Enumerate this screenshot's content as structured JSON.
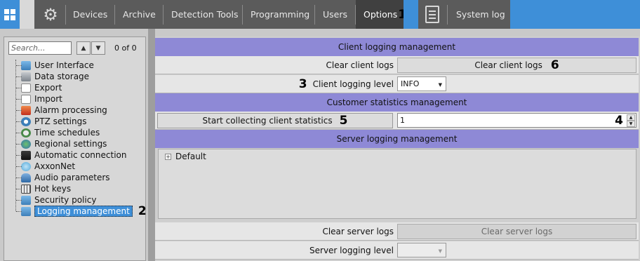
{
  "topbar": {
    "tabs": [
      {
        "label": "Devices"
      },
      {
        "label": "Archive"
      },
      {
        "label": "Detection Tools"
      },
      {
        "label": "Programming"
      },
      {
        "label": "Users"
      },
      {
        "label": "Options",
        "callout": "1"
      }
    ],
    "system_log_label": "System log",
    "icons": {
      "menu": "windows-grid-icon",
      "settings": "gear-icon",
      "system_log": "document-icon"
    },
    "colors": {
      "accent_blue": "#3e8fd8",
      "tab_bg": "#5b5b5b",
      "active_tab_bg": "#404040"
    }
  },
  "left": {
    "search_placeholder": "Search...",
    "counter": "0 of 0",
    "items": [
      {
        "label": "User Interface"
      },
      {
        "label": "Data storage"
      },
      {
        "label": "Export"
      },
      {
        "label": "Import"
      },
      {
        "label": "Alarm processing"
      },
      {
        "label": "PTZ settings"
      },
      {
        "label": "Time schedules"
      },
      {
        "label": "Regional settings"
      },
      {
        "label": "Automatic connection"
      },
      {
        "label": "AxxonNet"
      },
      {
        "label": "Audio parameters"
      },
      {
        "label": "Hot keys"
      },
      {
        "label": "Security policy"
      },
      {
        "label": "Logging management",
        "selected": true,
        "callout": "2"
      }
    ]
  },
  "main": {
    "client_header": "Client logging management",
    "clear_client_logs_label": "Clear client logs",
    "clear_client_logs_button": "Clear client logs",
    "clear_client_logs_callout": "6",
    "client_level_callout": "3",
    "client_level_label": "Client logging level",
    "client_level_value": "INFO",
    "stats_header": "Customer statistics management",
    "stats_button": "Start collecting client statistics",
    "stats_button_callout": "5",
    "stats_value": "1",
    "stats_value_callout": "4",
    "server_header": "Server logging management",
    "server_tree_item": "Default",
    "clear_server_logs_label": "Clear server logs",
    "clear_server_logs_button": "Clear server logs",
    "server_level_label": "Server logging level",
    "server_level_value": "",
    "colors": {
      "section_header": "#8e89d6",
      "selection": "#3e8fd8"
    }
  }
}
